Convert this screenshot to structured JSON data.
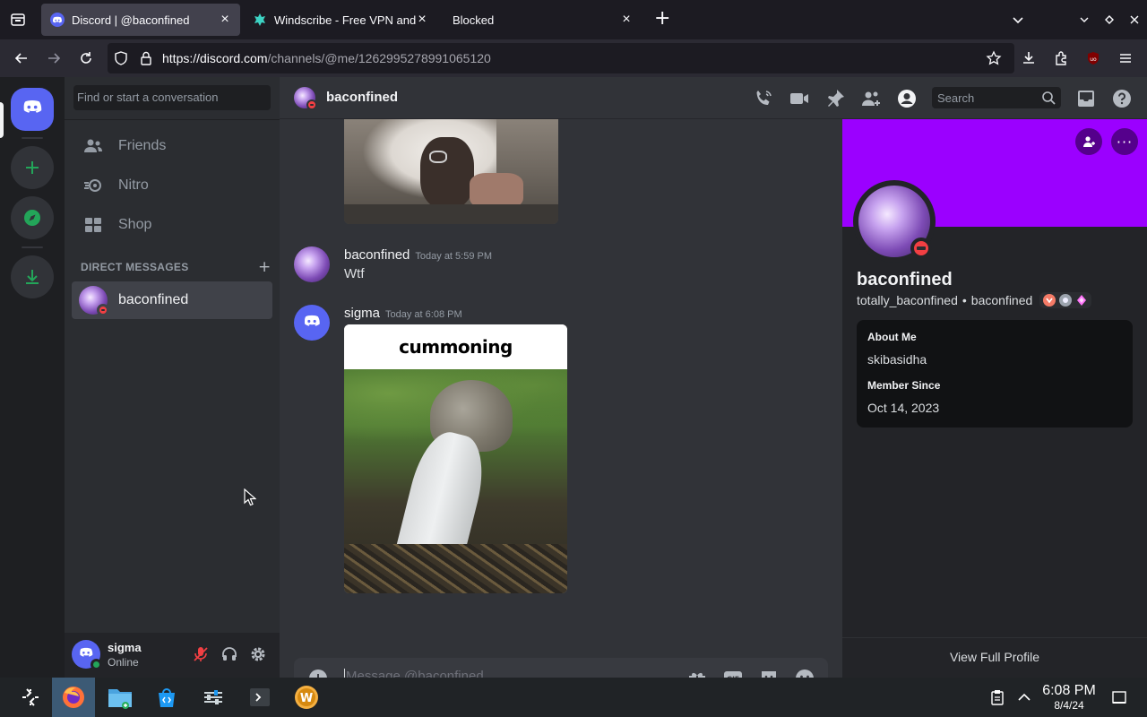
{
  "browser": {
    "tabs": [
      {
        "title": "Discord | @baconfined",
        "active": true
      },
      {
        "title": "Windscribe - Free VPN and",
        "active": false
      },
      {
        "title": "Blocked",
        "active": false
      }
    ],
    "url_host": "https://discord.com",
    "url_path": "/channels/@me/1262995278991065120"
  },
  "dm_sidebar": {
    "search_placeholder": "Find or start a conversation",
    "nav": [
      {
        "label": "Friends",
        "icon": "friends-icon"
      },
      {
        "label": "Nitro",
        "icon": "nitro-icon"
      },
      {
        "label": "Shop",
        "icon": "shop-icon"
      }
    ],
    "direct_messages_title": "DIRECT MESSAGES",
    "dm_item": {
      "name": "baconfined"
    }
  },
  "user_panel": {
    "name": "sigma",
    "status": "Online"
  },
  "chat": {
    "header_title": "baconfined",
    "search_placeholder": "Search",
    "messages": [
      {
        "author": "baconfined",
        "time": "Today at 5:59 PM",
        "text": "Wtf"
      },
      {
        "author": "sigma",
        "time": "Today at 6:08 PM",
        "image_caption": "cummoning"
      }
    ],
    "composer_placeholder": "Message @baconfined"
  },
  "profile": {
    "display_name": "baconfined",
    "username": "totally_baconfined",
    "separator": "•",
    "pronoun_tag": "baconfined",
    "about_me_label": "About Me",
    "about_me": "skibasidha",
    "member_since_label": "Member Since",
    "member_since": "Oct 14, 2023",
    "view_full_profile": "View Full Profile",
    "banner_color": "#9b00ff"
  },
  "taskbar": {
    "time": "6:08 PM",
    "date": "8/4/24"
  },
  "colors": {
    "discord_blurple": "#5865f2",
    "green": "#23a559",
    "dnd_red": "#f23f43"
  }
}
